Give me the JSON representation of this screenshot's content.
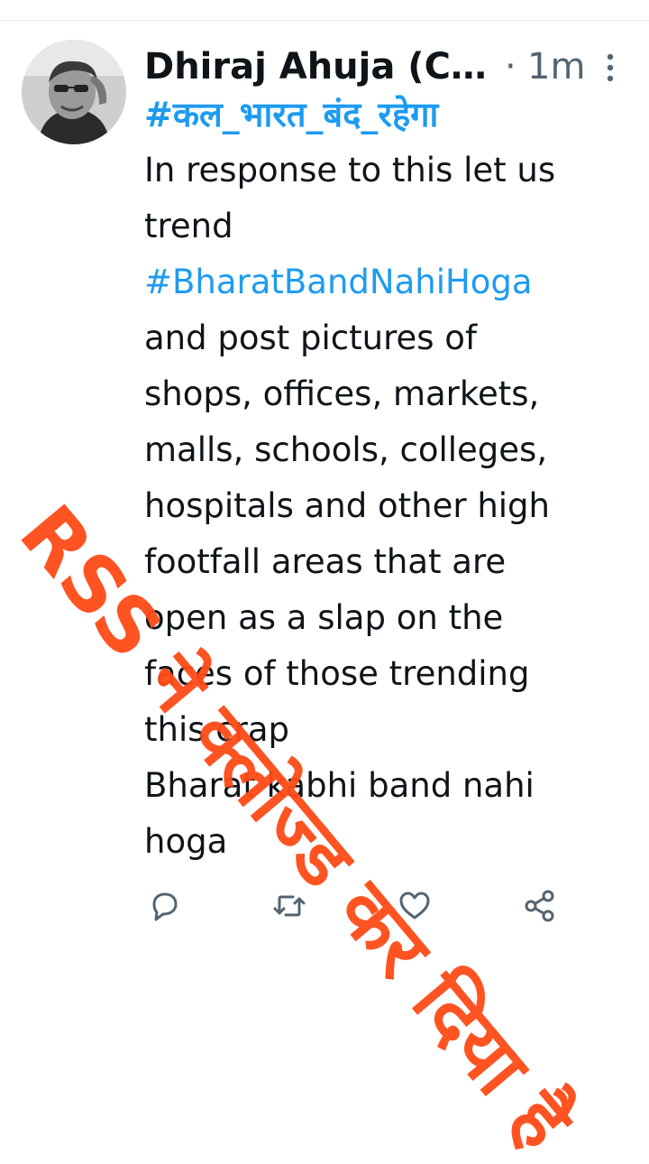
{
  "tweet": {
    "author_name": "Dhiraj Ahuja (C…",
    "time_separator": "·",
    "timestamp": "1m",
    "lines": [
      {
        "text": "#कल_भारत_बंद_रहेगा",
        "kind": "hashtag-hindi"
      },
      {
        "text": "In response to this let us",
        "kind": "text"
      },
      {
        "text": "trend",
        "kind": "text"
      },
      {
        "text": "#BharatBandNahiHoga",
        "kind": "hashtag"
      },
      {
        "text": "and post pictures of",
        "kind": "text"
      },
      {
        "text": "shops, offices, markets,",
        "kind": "text"
      },
      {
        "text": "malls, schools, colleges,",
        "kind": "text"
      },
      {
        "text": "hospitals and other high",
        "kind": "text"
      },
      {
        "text": "footfall areas that are",
        "kind": "text"
      },
      {
        "text": "open as a slap on the",
        "kind": "text"
      },
      {
        "text": "faces of those trending",
        "kind": "text"
      },
      {
        "text": "this crap",
        "kind": "text"
      },
      {
        "text": "Bharat kabhi band nahi",
        "kind": "text"
      },
      {
        "text": "hoga",
        "kind": "text"
      }
    ]
  },
  "watermark": {
    "text": "RSS ने क्लोज्ड कर दिया है",
    "color": "#ff4a17"
  },
  "actions": {
    "reply_icon": "reply-icon",
    "retweet_icon": "retweet-icon",
    "like_icon": "heart-icon",
    "share_icon": "share-icon"
  },
  "colors": {
    "text": "#0f1419",
    "secondary": "#536471",
    "link": "#1d9bf0",
    "watermark": "#ff4a17"
  }
}
